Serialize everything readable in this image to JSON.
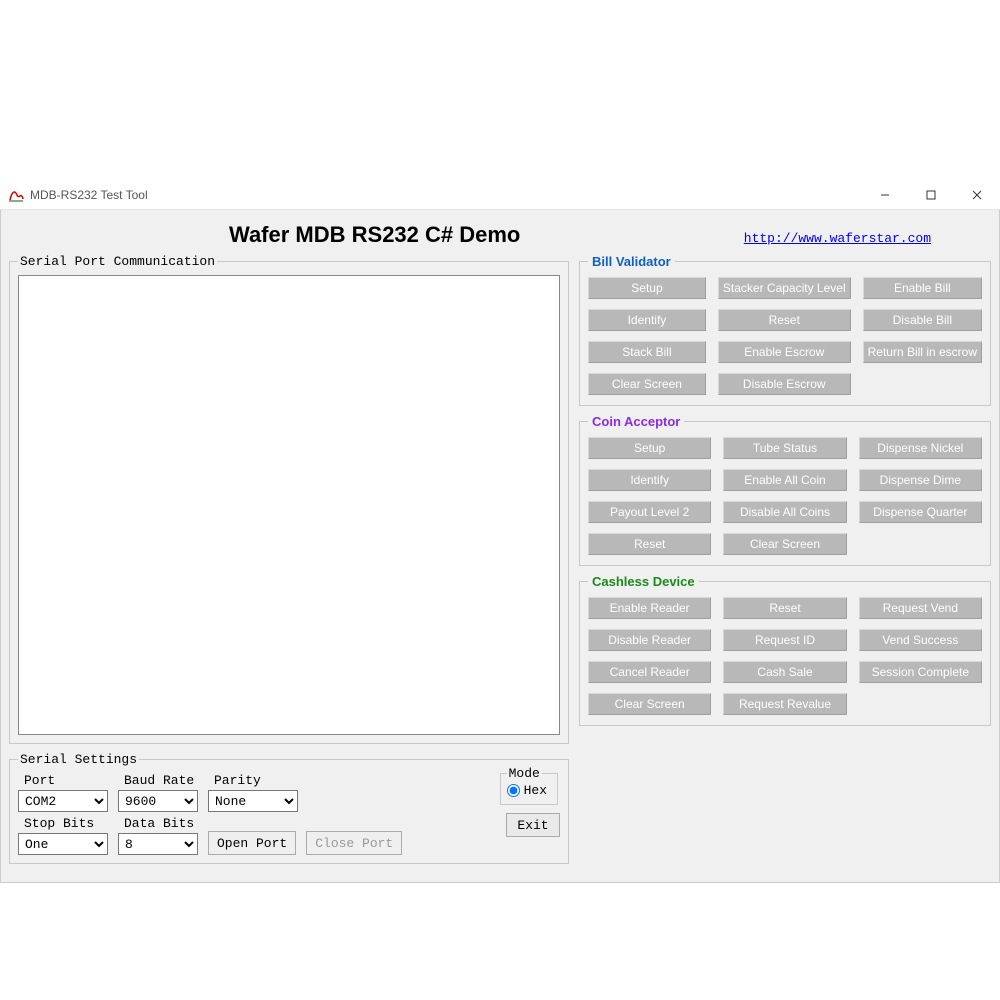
{
  "window": {
    "title": "MDB-RS232 Test Tool"
  },
  "header": {
    "app_title": "Wafer MDB RS232 C# Demo",
    "link_text": "http://www.waferstar.com"
  },
  "comm": {
    "legend": "Serial Port Communication"
  },
  "settings": {
    "legend": "Serial Settings",
    "port": {
      "label": "Port",
      "value": "COM2"
    },
    "baud": {
      "label": "Baud Rate",
      "value": "9600"
    },
    "parity": {
      "label": "Parity",
      "value": "None"
    },
    "stop": {
      "label": "Stop Bits",
      "value": "One"
    },
    "data": {
      "label": "Data Bits",
      "value": "8"
    },
    "open_label": "Open Port",
    "close_label": "Close Port",
    "mode_legend": "Mode",
    "mode_option": "Hex",
    "exit_label": "Exit"
  },
  "bill": {
    "legend": "Bill Validator",
    "buttons": {
      "setup": "Setup",
      "stacker": "Stacker Capacity Level",
      "enable_bill": "Enable Bill",
      "identify": "Identify",
      "reset": "Reset",
      "disable_bill": "Disable Bill",
      "stack_bill": "Stack Bill",
      "enable_escrow": "Enable Escrow",
      "return_escrow": "Return Bill in escrow",
      "clear": "Clear Screen",
      "disable_escrow": "Disable Escrow"
    }
  },
  "coin": {
    "legend": "Coin Acceptor",
    "buttons": {
      "setup": "Setup",
      "tube": "Tube Status",
      "nickel": "Dispense Nickel",
      "identify": "Identify",
      "enable_all": "Enable All Coin",
      "dime": "Dispense Dime",
      "payout2": "Payout Level 2",
      "disable_all": "Disable All Coins",
      "quarter": "Dispense Quarter",
      "reset": "Reset",
      "clear": "Clear Screen"
    }
  },
  "cashless": {
    "legend": "Cashless Device",
    "buttons": {
      "enable": "Enable Reader",
      "reset": "Reset",
      "request_vend": "Request Vend",
      "disable": "Disable Reader",
      "request_id": "Request ID",
      "vend_success": "Vend Success",
      "cancel": "Cancel Reader",
      "cash_sale": "Cash Sale",
      "session_complete": "Session Complete",
      "clear": "Clear Screen",
      "request_revalue": "Request Revalue"
    }
  }
}
